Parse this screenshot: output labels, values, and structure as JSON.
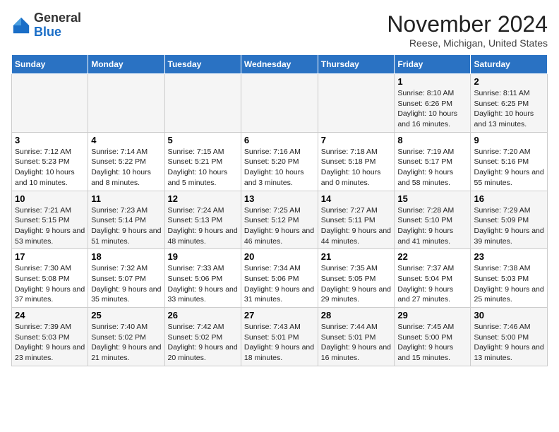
{
  "header": {
    "logo_general": "General",
    "logo_blue": "Blue",
    "month": "November 2024",
    "location": "Reese, Michigan, United States"
  },
  "days_of_week": [
    "Sunday",
    "Monday",
    "Tuesday",
    "Wednesday",
    "Thursday",
    "Friday",
    "Saturday"
  ],
  "weeks": [
    [
      {
        "day": "",
        "info": ""
      },
      {
        "day": "",
        "info": ""
      },
      {
        "day": "",
        "info": ""
      },
      {
        "day": "",
        "info": ""
      },
      {
        "day": "",
        "info": ""
      },
      {
        "day": "1",
        "info": "Sunrise: 8:10 AM\nSunset: 6:26 PM\nDaylight: 10 hours and 16 minutes."
      },
      {
        "day": "2",
        "info": "Sunrise: 8:11 AM\nSunset: 6:25 PM\nDaylight: 10 hours and 13 minutes."
      }
    ],
    [
      {
        "day": "3",
        "info": "Sunrise: 7:12 AM\nSunset: 5:23 PM\nDaylight: 10 hours and 10 minutes."
      },
      {
        "day": "4",
        "info": "Sunrise: 7:14 AM\nSunset: 5:22 PM\nDaylight: 10 hours and 8 minutes."
      },
      {
        "day": "5",
        "info": "Sunrise: 7:15 AM\nSunset: 5:21 PM\nDaylight: 10 hours and 5 minutes."
      },
      {
        "day": "6",
        "info": "Sunrise: 7:16 AM\nSunset: 5:20 PM\nDaylight: 10 hours and 3 minutes."
      },
      {
        "day": "7",
        "info": "Sunrise: 7:18 AM\nSunset: 5:18 PM\nDaylight: 10 hours and 0 minutes."
      },
      {
        "day": "8",
        "info": "Sunrise: 7:19 AM\nSunset: 5:17 PM\nDaylight: 9 hours and 58 minutes."
      },
      {
        "day": "9",
        "info": "Sunrise: 7:20 AM\nSunset: 5:16 PM\nDaylight: 9 hours and 55 minutes."
      }
    ],
    [
      {
        "day": "10",
        "info": "Sunrise: 7:21 AM\nSunset: 5:15 PM\nDaylight: 9 hours and 53 minutes."
      },
      {
        "day": "11",
        "info": "Sunrise: 7:23 AM\nSunset: 5:14 PM\nDaylight: 9 hours and 51 minutes."
      },
      {
        "day": "12",
        "info": "Sunrise: 7:24 AM\nSunset: 5:13 PM\nDaylight: 9 hours and 48 minutes."
      },
      {
        "day": "13",
        "info": "Sunrise: 7:25 AM\nSunset: 5:12 PM\nDaylight: 9 hours and 46 minutes."
      },
      {
        "day": "14",
        "info": "Sunrise: 7:27 AM\nSunset: 5:11 PM\nDaylight: 9 hours and 44 minutes."
      },
      {
        "day": "15",
        "info": "Sunrise: 7:28 AM\nSunset: 5:10 PM\nDaylight: 9 hours and 41 minutes."
      },
      {
        "day": "16",
        "info": "Sunrise: 7:29 AM\nSunset: 5:09 PM\nDaylight: 9 hours and 39 minutes."
      }
    ],
    [
      {
        "day": "17",
        "info": "Sunrise: 7:30 AM\nSunset: 5:08 PM\nDaylight: 9 hours and 37 minutes."
      },
      {
        "day": "18",
        "info": "Sunrise: 7:32 AM\nSunset: 5:07 PM\nDaylight: 9 hours and 35 minutes."
      },
      {
        "day": "19",
        "info": "Sunrise: 7:33 AM\nSunset: 5:06 PM\nDaylight: 9 hours and 33 minutes."
      },
      {
        "day": "20",
        "info": "Sunrise: 7:34 AM\nSunset: 5:06 PM\nDaylight: 9 hours and 31 minutes."
      },
      {
        "day": "21",
        "info": "Sunrise: 7:35 AM\nSunset: 5:05 PM\nDaylight: 9 hours and 29 minutes."
      },
      {
        "day": "22",
        "info": "Sunrise: 7:37 AM\nSunset: 5:04 PM\nDaylight: 9 hours and 27 minutes."
      },
      {
        "day": "23",
        "info": "Sunrise: 7:38 AM\nSunset: 5:03 PM\nDaylight: 9 hours and 25 minutes."
      }
    ],
    [
      {
        "day": "24",
        "info": "Sunrise: 7:39 AM\nSunset: 5:03 PM\nDaylight: 9 hours and 23 minutes."
      },
      {
        "day": "25",
        "info": "Sunrise: 7:40 AM\nSunset: 5:02 PM\nDaylight: 9 hours and 21 minutes."
      },
      {
        "day": "26",
        "info": "Sunrise: 7:42 AM\nSunset: 5:02 PM\nDaylight: 9 hours and 20 minutes."
      },
      {
        "day": "27",
        "info": "Sunrise: 7:43 AM\nSunset: 5:01 PM\nDaylight: 9 hours and 18 minutes."
      },
      {
        "day": "28",
        "info": "Sunrise: 7:44 AM\nSunset: 5:01 PM\nDaylight: 9 hours and 16 minutes."
      },
      {
        "day": "29",
        "info": "Sunrise: 7:45 AM\nSunset: 5:00 PM\nDaylight: 9 hours and 15 minutes."
      },
      {
        "day": "30",
        "info": "Sunrise: 7:46 AM\nSunset: 5:00 PM\nDaylight: 9 hours and 13 minutes."
      }
    ]
  ]
}
